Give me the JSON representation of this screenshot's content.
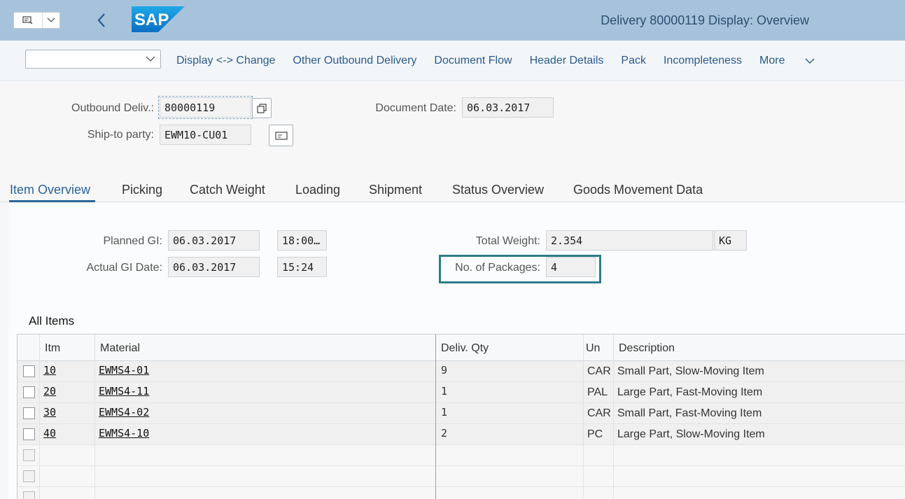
{
  "header": {
    "title": "Delivery 80000119 Display: Overview",
    "logo_text": "SAP"
  },
  "toolbar": {
    "select_value": "",
    "items": [
      "Display <-> Change",
      "Other Outbound Delivery",
      "Document Flow",
      "Header Details",
      "Pack",
      "Incompleteness"
    ],
    "more_label": "More"
  },
  "doc_header": {
    "outbound_deliv_label": "Outbound Deliv.:",
    "outbound_deliv_value": "80000119",
    "ship_to_label": "Ship-to party:",
    "ship_to_value": "EWM10-CU01",
    "doc_date_label": "Document Date:",
    "doc_date_value": "06.03.2017"
  },
  "tabs": [
    "Item Overview",
    "Picking",
    "Catch Weight",
    "Loading",
    "Shipment",
    "Status Overview",
    "Goods Movement Data"
  ],
  "overview": {
    "planned_gi_label": "Planned GI:",
    "planned_gi_date": "06.03.2017",
    "planned_gi_time": "18:00…",
    "actual_gi_label": "Actual GI Date:",
    "actual_gi_date": "06.03.2017",
    "actual_gi_time": "15:24",
    "total_weight_label": "Total Weight:",
    "total_weight_value": "2.354",
    "weight_unit": "KG",
    "packages_label": "No. of Packages:",
    "packages_value": "4"
  },
  "items_table": {
    "title": "All Items",
    "columns": [
      "Itm",
      "Material",
      "Deliv. Qty",
      "Un",
      "Description"
    ],
    "rows": [
      {
        "itm": "10",
        "material": "EWMS4-01",
        "qty": "9",
        "un": "CAR",
        "desc": "Small Part, Slow-Moving Item"
      },
      {
        "itm": "20",
        "material": "EWMS4-11",
        "qty": "1",
        "un": "PAL",
        "desc": "Large Part, Fast-Moving Item"
      },
      {
        "itm": "30",
        "material": "EWMS4-02",
        "qty": "1",
        "un": "CAR",
        "desc": "Small Part, Fast-Moving Item"
      },
      {
        "itm": "40",
        "material": "EWMS4-10",
        "qty": "2",
        "un": "PC",
        "desc": "Large Part, Slow-Moving Item"
      }
    ]
  }
}
